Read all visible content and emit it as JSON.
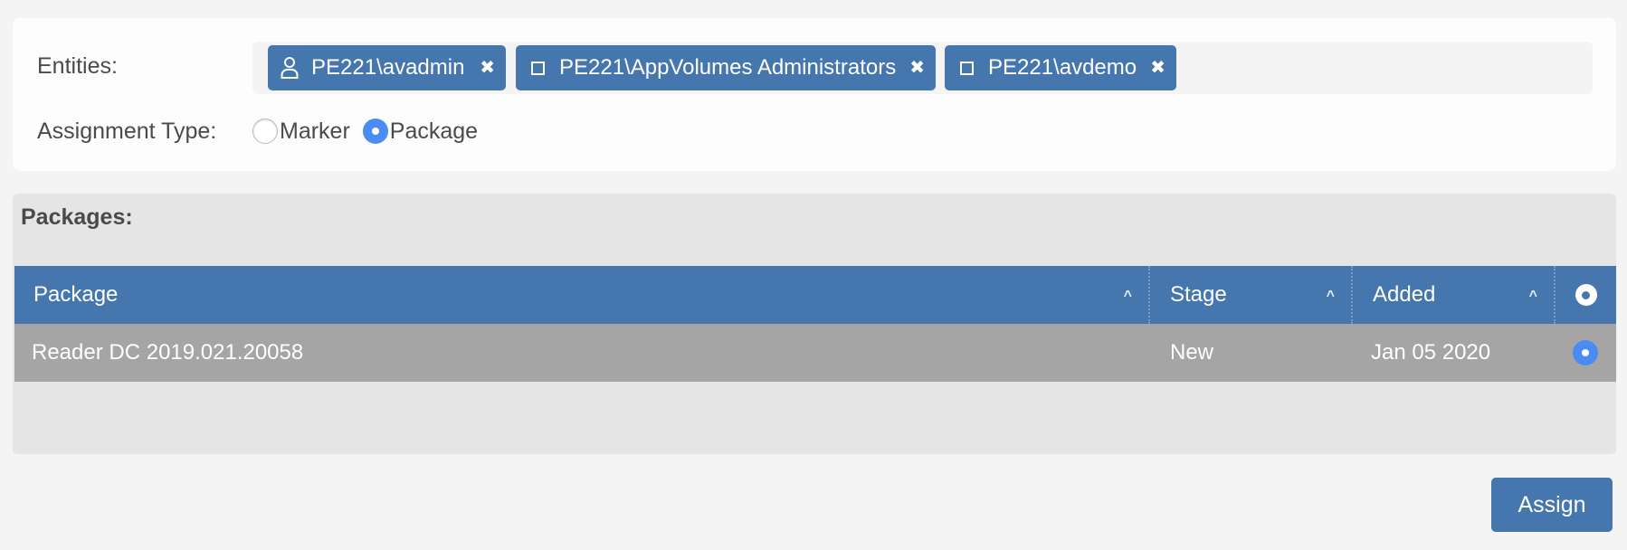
{
  "form": {
    "entities_label": "Entities:",
    "assignment_type_label": "Assignment Type:",
    "entities": [
      {
        "icon": "user-icon",
        "label": "PE221\\avadmin",
        "remove_icon": "close-icon"
      },
      {
        "icon": "group-icon",
        "label": "PE221\\AppVolumes Administrators",
        "remove_icon": "close-icon"
      },
      {
        "icon": "group-icon",
        "label": "PE221\\avdemo",
        "remove_icon": "close-icon"
      }
    ],
    "assignment_types": [
      {
        "label": "Marker",
        "selected": false
      },
      {
        "label": "Package",
        "selected": true
      }
    ]
  },
  "packages": {
    "title": "Packages:",
    "columns": [
      {
        "label": "Package",
        "sort": "ascending"
      },
      {
        "label": "Stage",
        "sort": "ascending"
      },
      {
        "label": "Added",
        "sort": "ascending"
      },
      {
        "label": "",
        "icon": "radio-header-icon"
      }
    ],
    "rows": [
      {
        "package": "Reader DC 2019.021.20058",
        "stage": "New",
        "added": "Jan 05 2020",
        "selected": true
      }
    ]
  },
  "actions": {
    "assign_label": "Assign"
  },
  "colors": {
    "primary": "#4576ae",
    "radio_selected": "#4b8bf4",
    "row_selected": "#a5a5a5",
    "panel_bg": "#e5e5e5",
    "page_bg": "#f4f4f4"
  }
}
